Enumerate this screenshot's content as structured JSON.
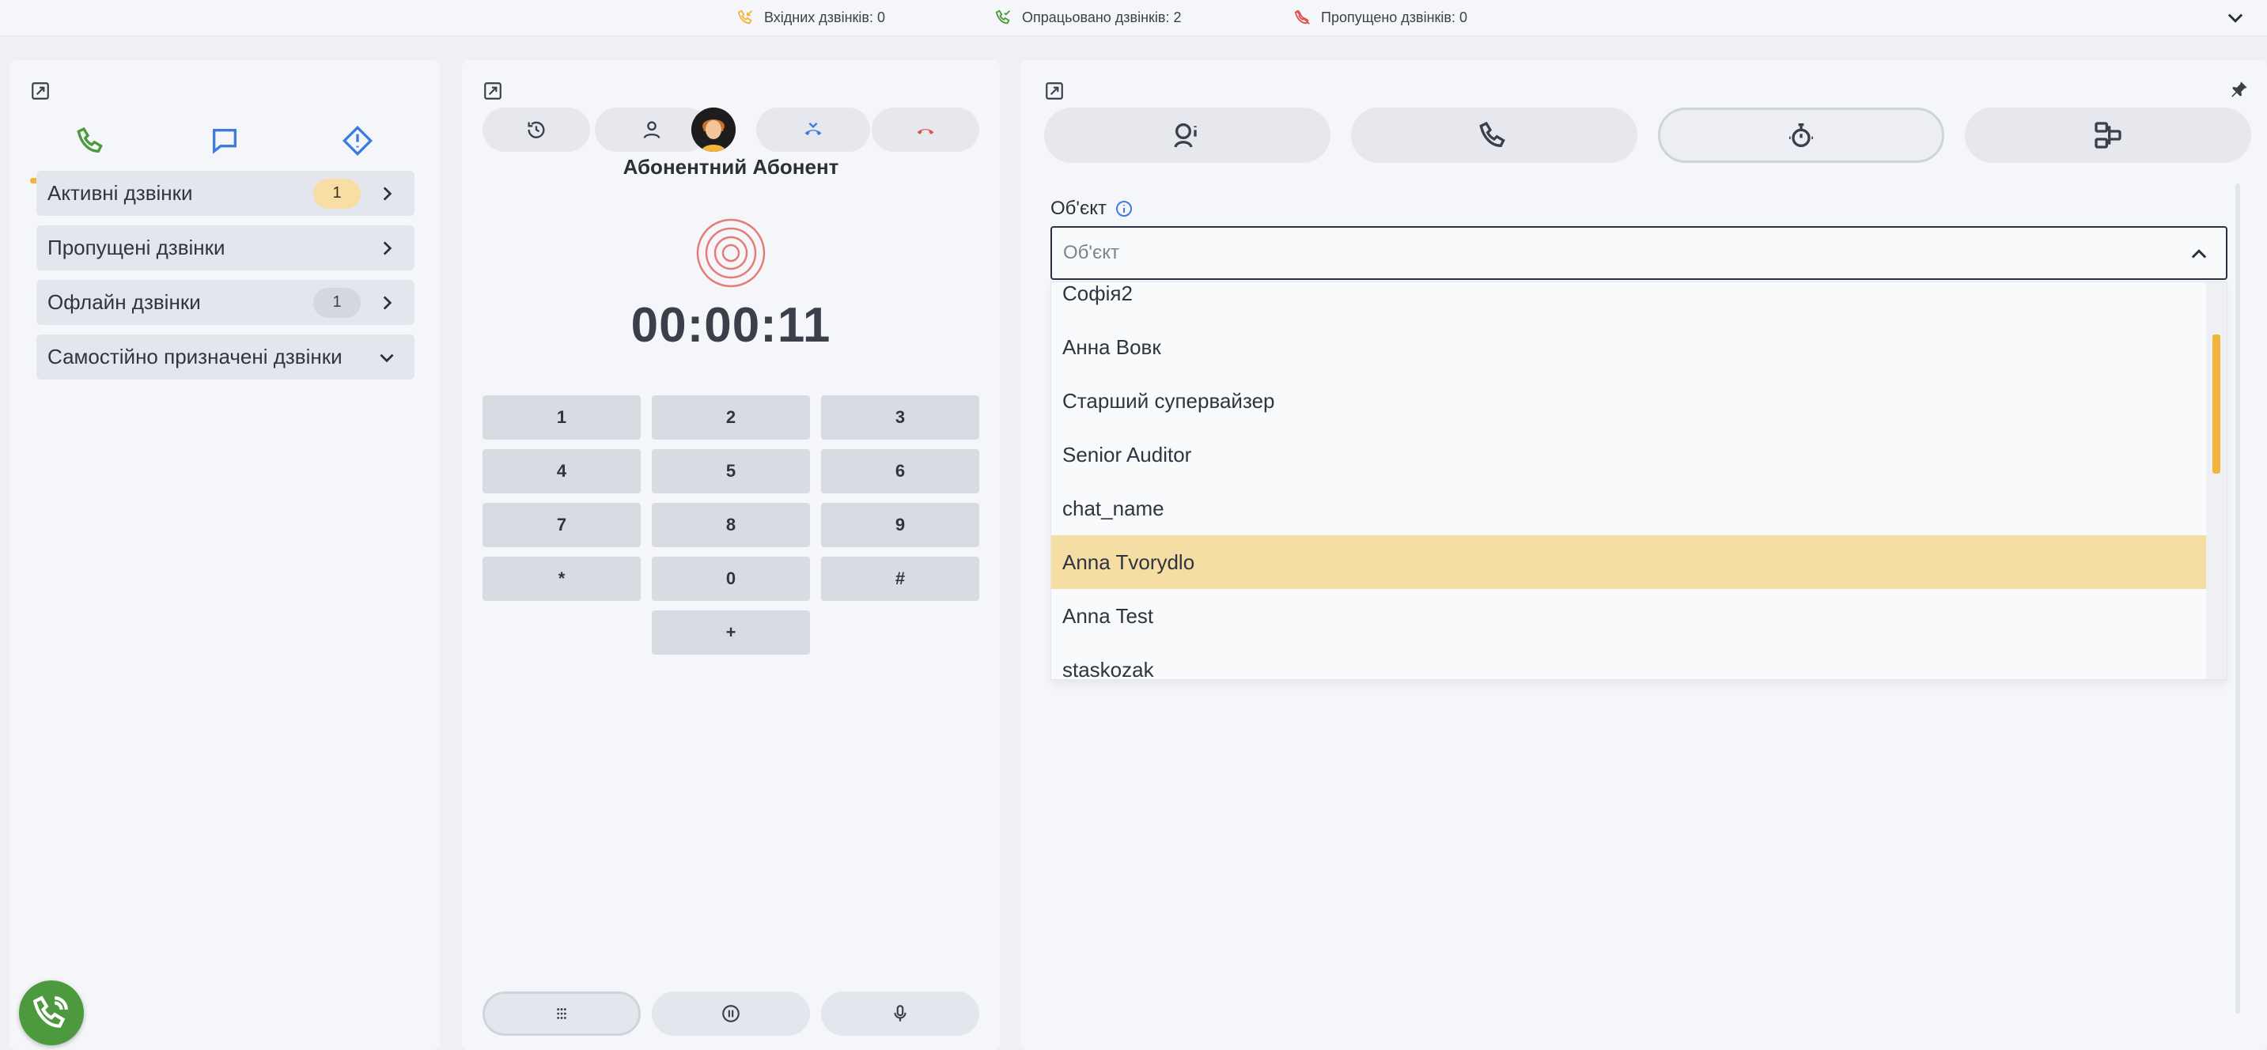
{
  "stats": {
    "incoming": "Вхідних дзвінків: 0",
    "processed": "Опрацьовано дзвінків: 2",
    "missed": "Пропущено дзвінків: 0"
  },
  "left": {
    "tabs": [
      "phone-icon",
      "chat-icon",
      "alert-icon"
    ],
    "items": [
      {
        "label": "Активні дзвінки",
        "badge": "1"
      },
      {
        "label": "Пропущені дзвінки",
        "badge": ""
      },
      {
        "label": "Офлайн дзвінки",
        "badge": "1"
      },
      {
        "label": "Самостійно призначені дзвінки",
        "badge": ""
      }
    ]
  },
  "middle": {
    "subscriber_name": "Абонентний Абонент",
    "timer": "00:00:11",
    "keys": [
      "1",
      "2",
      "3",
      "4",
      "5",
      "6",
      "7",
      "8",
      "9",
      "*",
      "0",
      "#",
      "+"
    ]
  },
  "right": {
    "field_label": "Об'єкт",
    "select_placeholder": "Об'єкт",
    "options": [
      "Софія2",
      "Анна Вовк",
      "Старший супервайзер",
      "Senior Auditor",
      "chat_name",
      "Anna Tvorydlo",
      "Anna Test",
      "staskozak"
    ],
    "selected_option": "Anna Tvorydlo"
  },
  "colors": {
    "accent": "#f1b53b",
    "highlight": "#f5dea4",
    "green": "#4c9a3d",
    "blue": "#3d7be0",
    "red": "#e0524e"
  }
}
